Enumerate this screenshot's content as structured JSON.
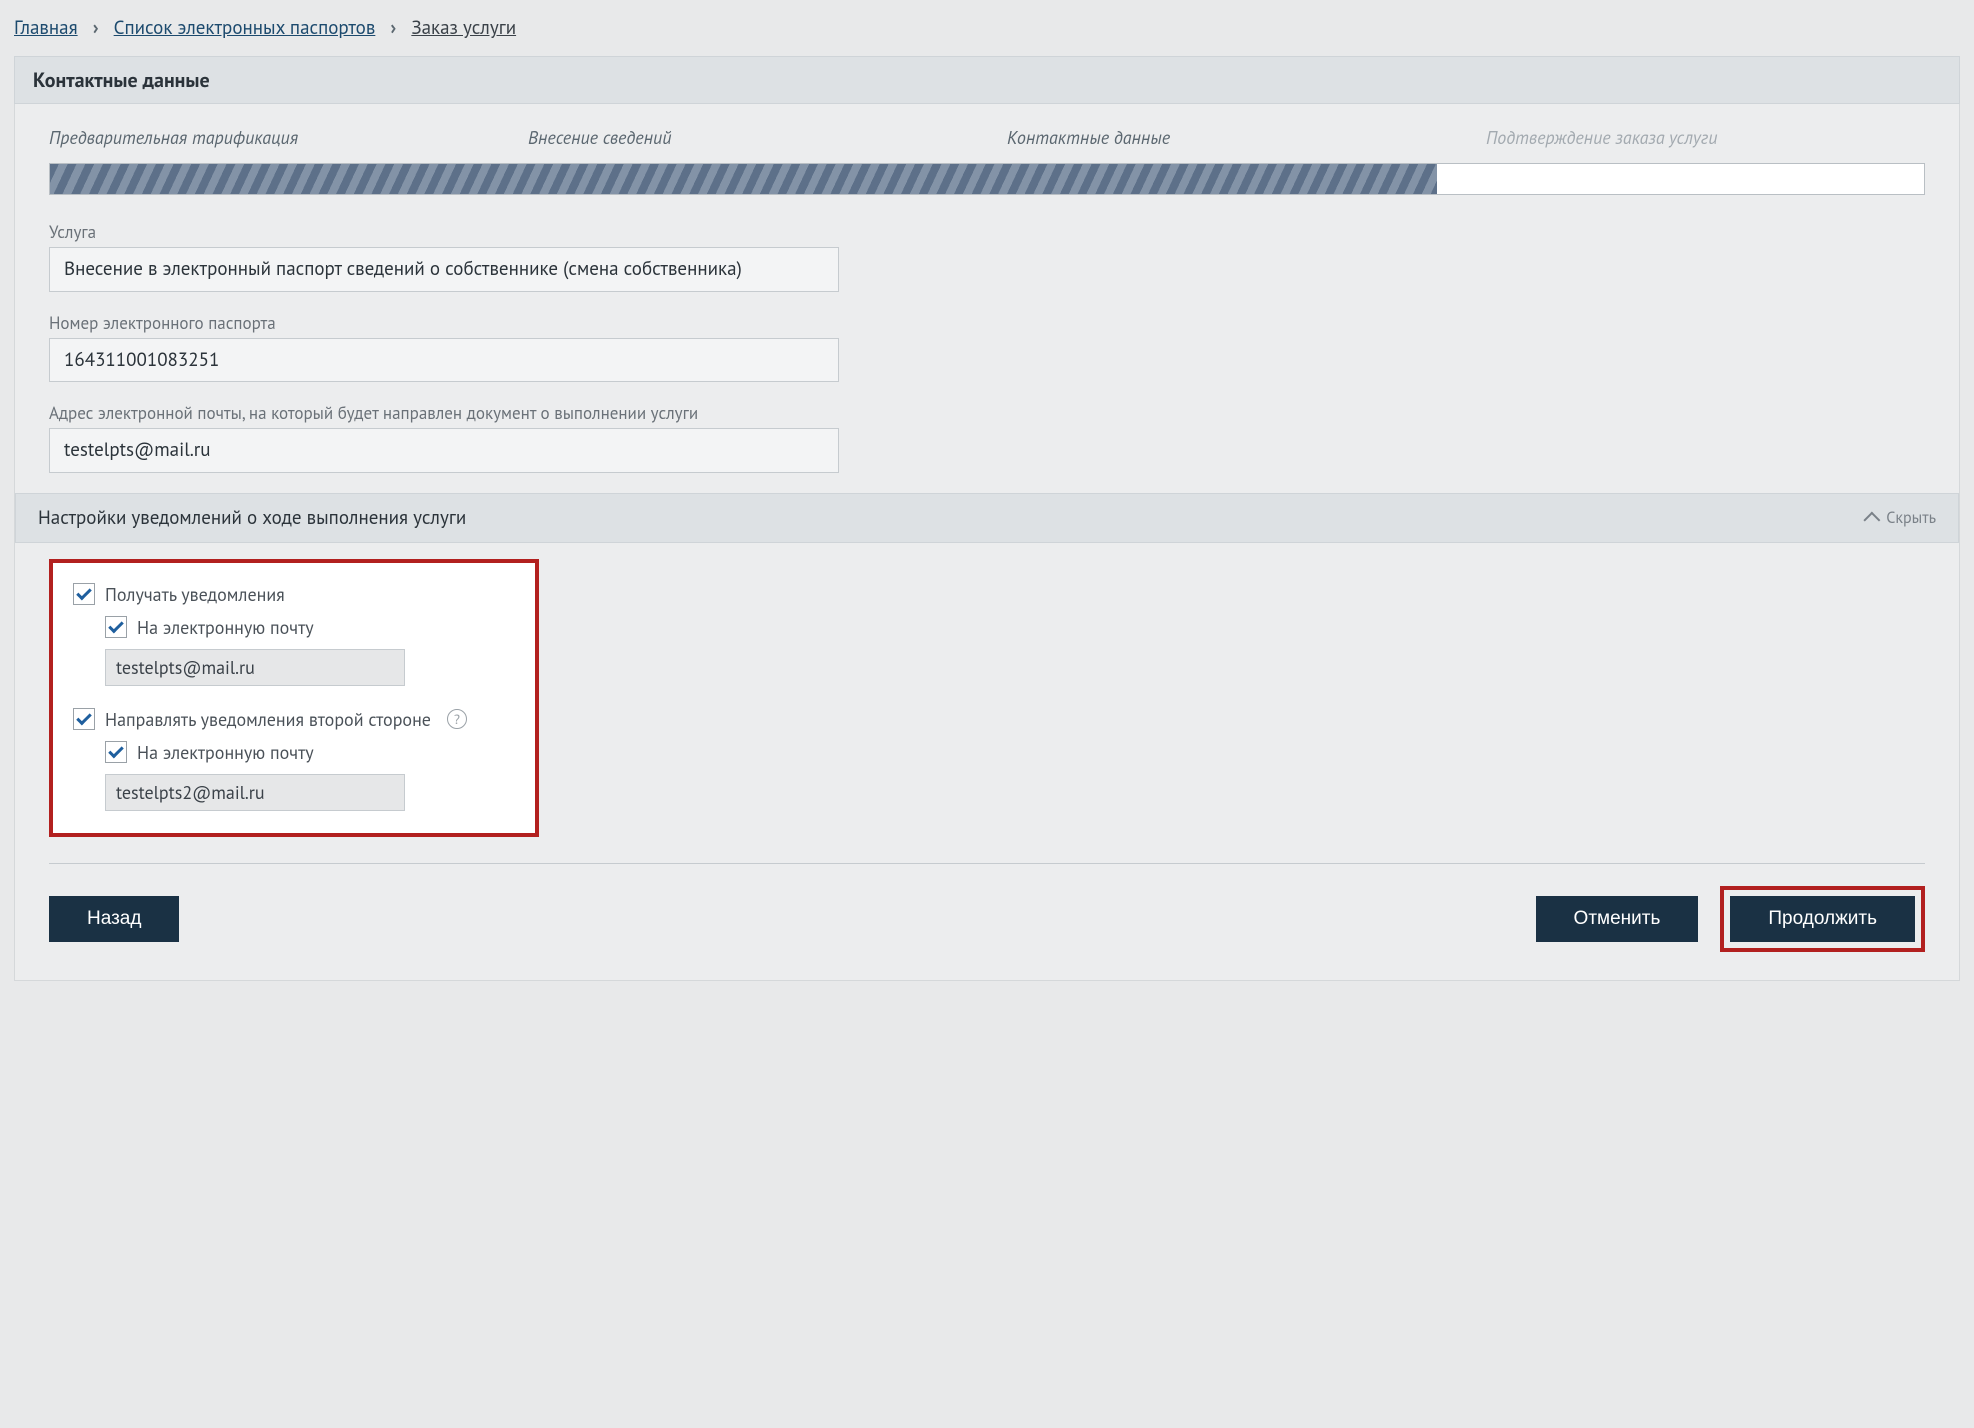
{
  "breadcrumbs": {
    "home": "Главная",
    "list": "Список электронных паспортов",
    "current": "Заказ услуги"
  },
  "section_title": "Контактные данные",
  "wizard": {
    "step1": "Предварительная тарификация",
    "step2": "Внесение сведений",
    "step3": "Контактные данные",
    "step4": "Подтверждение заказа услуги"
  },
  "fields": {
    "service_label": "Услуга",
    "service_value": "Внесение в электронный паспорт сведений о собственнике (смена собственника)",
    "passport_label": "Номер электронного паспорта",
    "passport_value": "164311001083251",
    "email_label": "Адрес электронной почты, на который будет направлен документ о выполнении услуги",
    "email_value": "testelpts@mail.ru"
  },
  "notifications": {
    "header": "Настройки уведомлений о ходе выполнения услуги",
    "toggle_label": "Скрыть",
    "receive_label": "Получать уведомления",
    "by_email_label": "На электронную почту",
    "email1": "testelpts@mail.ru",
    "second_party_label": "Направлять уведомления второй стороне",
    "email2": "testelpts2@mail.ru"
  },
  "buttons": {
    "back": "Назад",
    "cancel": "Отменить",
    "continue": "Продолжить"
  }
}
